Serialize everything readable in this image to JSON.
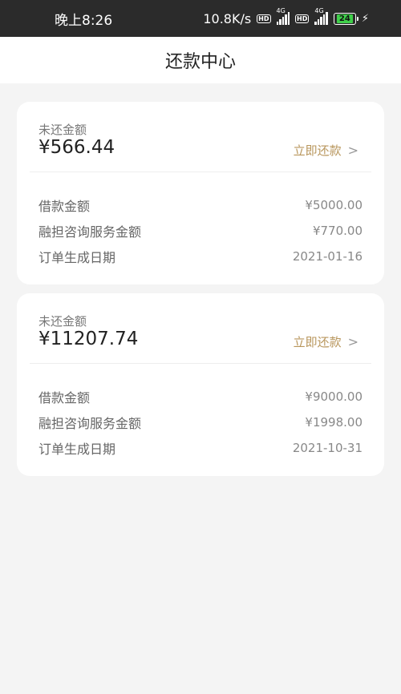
{
  "status_bar": {
    "time": "晚上8:26",
    "net_speed": "10.8K/s",
    "hd1": "HD",
    "g1": "4G",
    "hd2": "HD",
    "g2": "4G",
    "battery": "24"
  },
  "header": {
    "title": "还款中心"
  },
  "cards": [
    {
      "unpaid_label": "未还金额",
      "amount": "¥566.44",
      "repay_label": "立即还款",
      "rows": [
        {
          "k": "借款金额",
          "v": "¥5000.00"
        },
        {
          "k": "融担咨询服务金额",
          "v": "¥770.00"
        },
        {
          "k": "订单生成日期",
          "v": "2021-01-16"
        }
      ]
    },
    {
      "unpaid_label": "未还金额",
      "amount": "¥11207.74",
      "repay_label": "立即还款",
      "rows": [
        {
          "k": "借款金额",
          "v": "¥9000.00"
        },
        {
          "k": "融担咨询服务金额",
          "v": "¥1998.00"
        },
        {
          "k": "订单生成日期",
          "v": "2021-10-31"
        }
      ]
    }
  ],
  "colors": {
    "accent": "#b8965c",
    "status_bar_bg": "#2b2b2b",
    "battery_green": "#3fcf4a"
  }
}
